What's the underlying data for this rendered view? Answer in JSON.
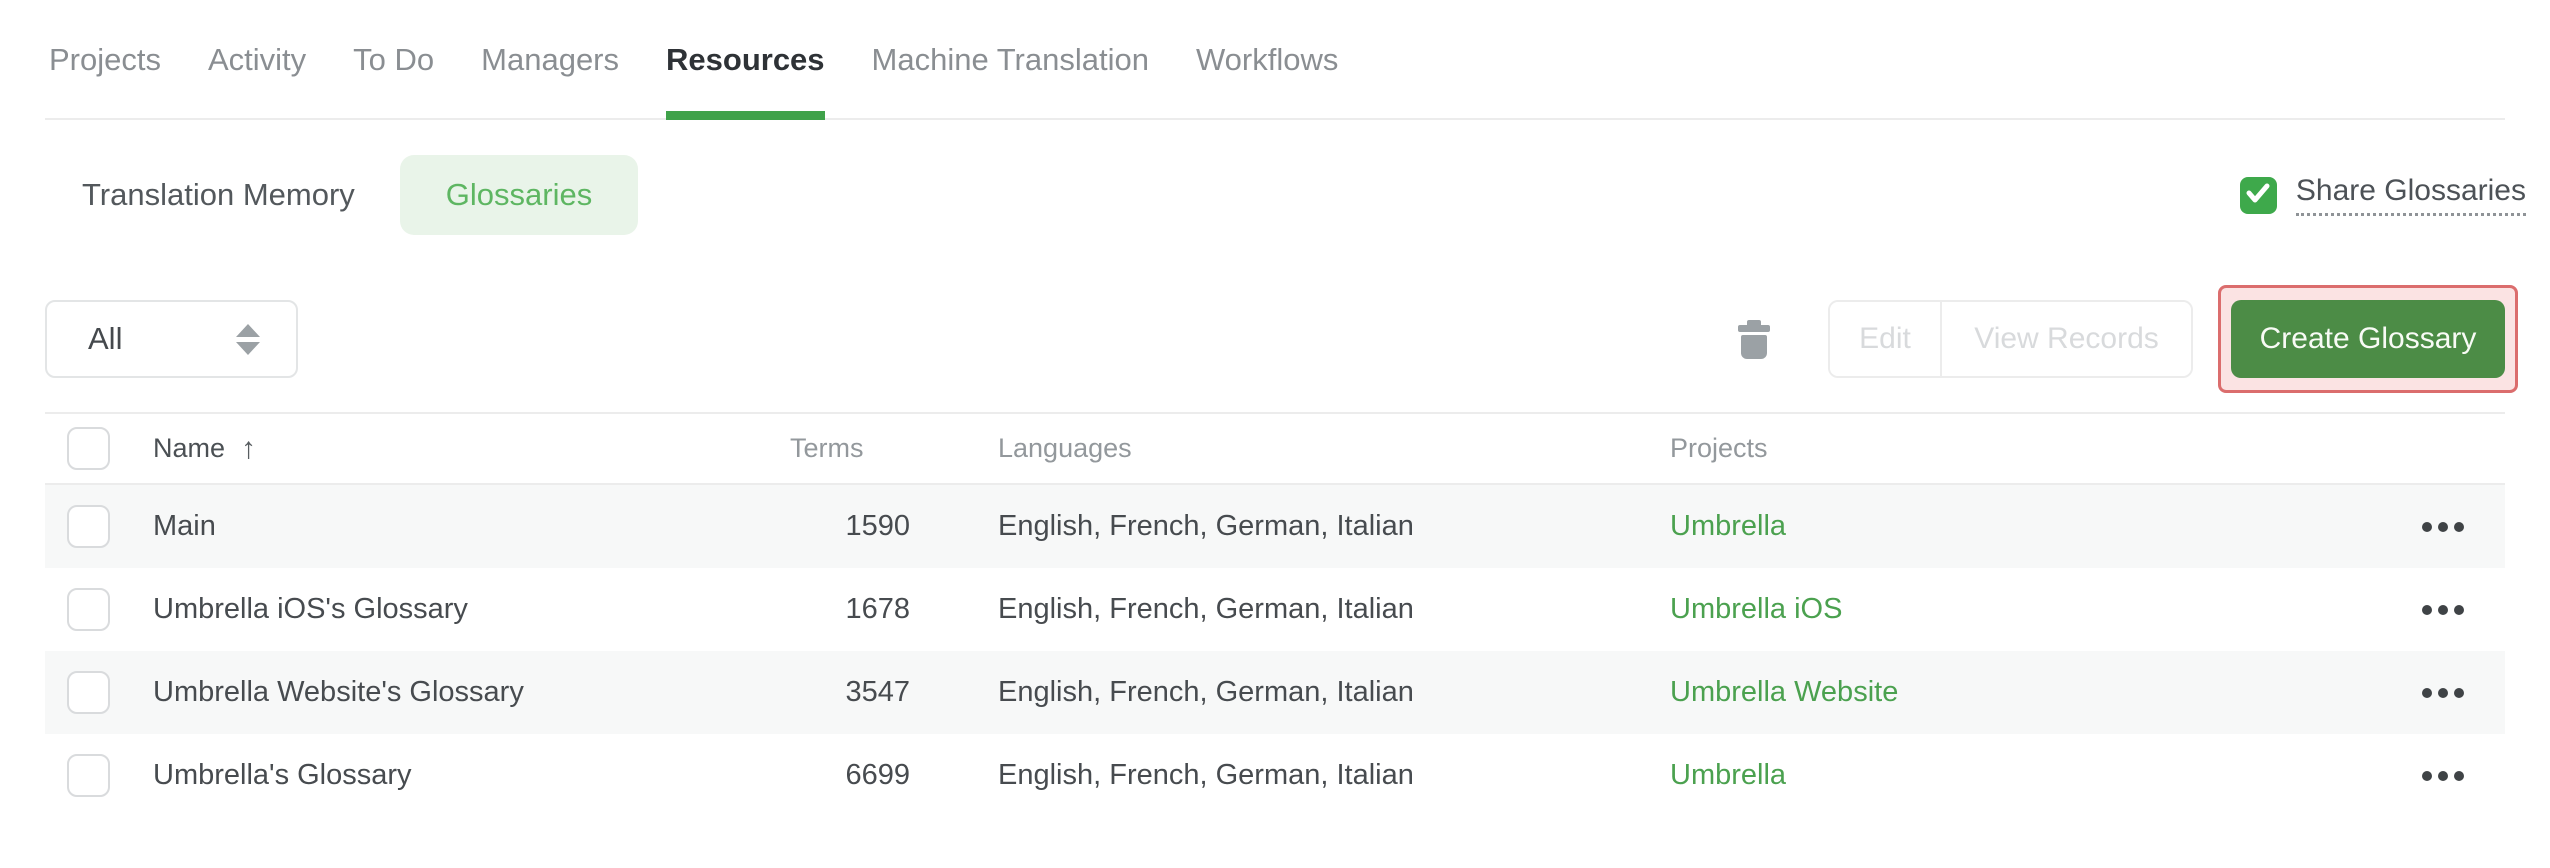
{
  "nav": {
    "tabs": [
      {
        "label": "Projects",
        "active": false
      },
      {
        "label": "Activity",
        "active": false
      },
      {
        "label": "To Do",
        "active": false
      },
      {
        "label": "Managers",
        "active": false
      },
      {
        "label": "Resources",
        "active": true
      },
      {
        "label": "Machine Translation",
        "active": false
      },
      {
        "label": "Workflows",
        "active": false
      }
    ]
  },
  "subtabs": {
    "translation_memory_label": "Translation Memory",
    "glossaries_label": "Glossaries",
    "active_subtab": "Glossaries",
    "share_glossaries_label": "Share Glossaries",
    "share_checked": true
  },
  "toolbar": {
    "filter_value": "All",
    "edit_label": "Edit",
    "view_records_label": "View Records",
    "create_label": "Create Glossary",
    "edit_enabled": false,
    "view_records_enabled": false
  },
  "table": {
    "headers": {
      "name": "Name",
      "terms": "Terms",
      "languages": "Languages",
      "projects": "Projects"
    },
    "sort": {
      "column": "Name",
      "direction": "ascending"
    },
    "rows": [
      {
        "name": "Main",
        "terms": "1590",
        "languages": "English, French, German, Italian",
        "project": "Umbrella",
        "checked": false
      },
      {
        "name": "Umbrella iOS's Glossary",
        "terms": "1678",
        "languages": "English, French, German, Italian",
        "project": "Umbrella iOS",
        "checked": false
      },
      {
        "name": "Umbrella Website's Glossary",
        "terms": "3547",
        "languages": "English, French, German, Italian",
        "project": "Umbrella Website",
        "checked": false
      },
      {
        "name": "Umbrella's Glossary",
        "terms": "6699",
        "languages": "English, French, German, Italian",
        "project": "Umbrella",
        "checked": false
      }
    ]
  },
  "icons": {
    "sort_ascending_glyph": "↑",
    "checkmark_icon": "check",
    "trash_icon": "trash-can",
    "select_arrows_icon": "up-down-triangles",
    "row_menu_icon": "three-dots"
  },
  "colors": {
    "accent_green": "#3fa24a",
    "link_green": "#4ba14f",
    "pill_bg": "#e9f4e9",
    "pill_text": "#5eb662",
    "button_green": "#4c8c46",
    "highlight_border": "#db6d6d",
    "highlight_bg": "#fbe3e3",
    "zebra_row": "#f7f8f8",
    "disabled_text": "#d8dadc"
  }
}
